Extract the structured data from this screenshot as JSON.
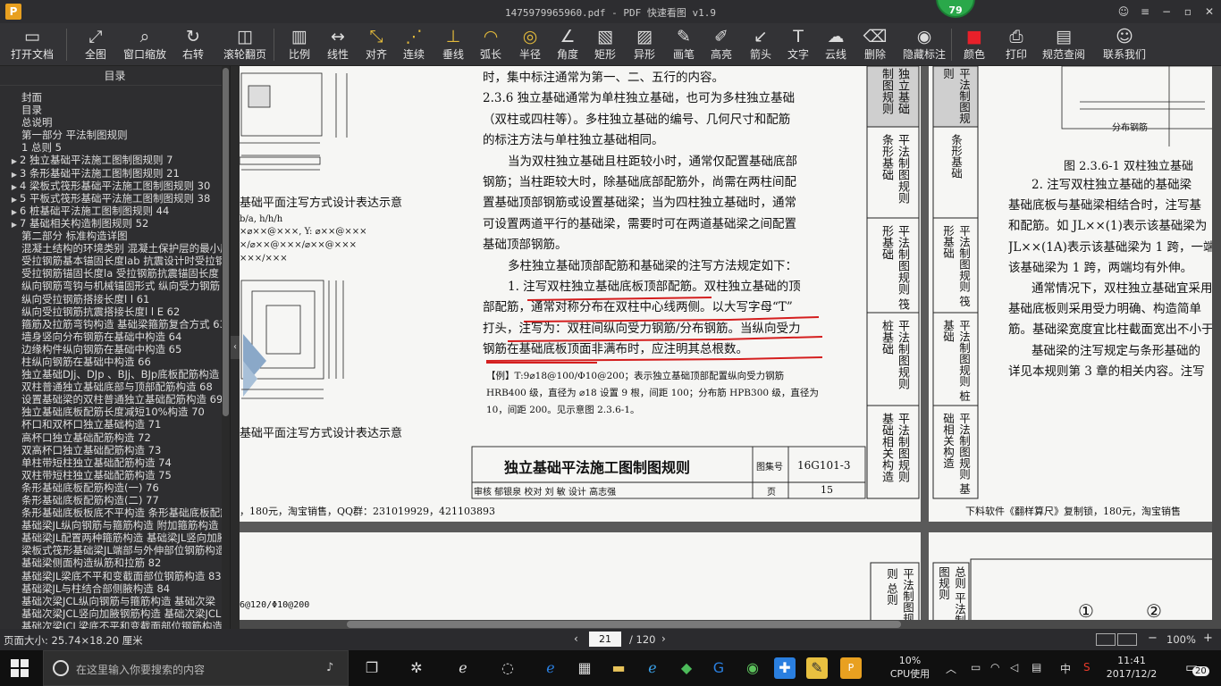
{
  "window": {
    "title": "1475979965960.pdf - PDF 快速看图 v1.9",
    "badge": "79",
    "logo": "P"
  },
  "toolbar": [
    {
      "label": "打开文档",
      "icon": "folder-icon",
      "glyph": "▭"
    },
    {
      "label": "全图",
      "icon": "fit-all-icon",
      "glyph": "⤢"
    },
    {
      "label": "窗口缩放",
      "icon": "zoom-icon",
      "glyph": "⌕"
    },
    {
      "label": "右转",
      "icon": "rotate-right-icon",
      "glyph": "↻"
    },
    {
      "label": "滚轮翻页",
      "icon": "mouse-icon",
      "glyph": "◫"
    },
    {
      "label": "比例",
      "icon": "scale-icon",
      "glyph": "▥"
    },
    {
      "label": "线性",
      "icon": "linear-measure-icon",
      "glyph": "↔"
    },
    {
      "label": "对齐",
      "icon": "aligned-measure-icon",
      "glyph": "⤡"
    },
    {
      "label": "连续",
      "icon": "continuous-measure-icon",
      "glyph": "⋰"
    },
    {
      "label": "垂线",
      "icon": "perpendicular-icon",
      "glyph": "⊥"
    },
    {
      "label": "弧长",
      "icon": "arc-length-icon",
      "glyph": "◠"
    },
    {
      "label": "半径",
      "icon": "radius-icon",
      "glyph": "◎"
    },
    {
      "label": "角度",
      "icon": "angle-icon",
      "glyph": "∠"
    },
    {
      "label": "矩形",
      "icon": "rectangle-area-icon",
      "glyph": "▧"
    },
    {
      "label": "异形",
      "icon": "irregular-area-icon",
      "glyph": "▨"
    },
    {
      "label": "画笔",
      "icon": "pen-icon",
      "glyph": "✎"
    },
    {
      "label": "高亮",
      "icon": "highlighter-icon",
      "glyph": "✐"
    },
    {
      "label": "箭头",
      "icon": "arrow-icon",
      "glyph": "↙"
    },
    {
      "label": "文字",
      "icon": "text-icon",
      "glyph": "T"
    },
    {
      "label": "云线",
      "icon": "cloud-line-icon",
      "glyph": "☁"
    },
    {
      "label": "删除",
      "icon": "eraser-icon",
      "glyph": "⌫"
    },
    {
      "label": "隐藏标注",
      "icon": "hide-annotations-icon",
      "glyph": "◉"
    },
    {
      "label": "颜色",
      "icon": "color-swatch-icon",
      "glyph": "■",
      "color": "#e8202a"
    },
    {
      "label": "打印",
      "icon": "printer-icon",
      "glyph": "⎙"
    },
    {
      "label": "规范查阅",
      "icon": "book-search-icon",
      "glyph": "▤"
    },
    {
      "label": "联系我们",
      "icon": "contact-icon",
      "glyph": "☺"
    }
  ],
  "sidebar": {
    "title": "目录",
    "items": [
      {
        "text": "封面",
        "arrow": false
      },
      {
        "text": "目录",
        "arrow": false
      },
      {
        "text": "总说明",
        "arrow": false
      },
      {
        "text": "第一部分  平法制图规则",
        "arrow": false
      },
      {
        "text": "1 总则 5",
        "arrow": false
      },
      {
        "text": "2 独立基础平法施工图制图规则 7",
        "arrow": true
      },
      {
        "text": "3 条形基础平法施工图制图规则 21",
        "arrow": true
      },
      {
        "text": "4 梁板式筏形基础平法施工图制图规则 30",
        "arrow": true
      },
      {
        "text": "5 平板式筏形基础平法施工图制图规则 38",
        "arrow": true
      },
      {
        "text": "6 桩基础平法施工图制图规则 44",
        "arrow": true
      },
      {
        "text": "7 基础相关构造制图规则 52",
        "arrow": true
      },
      {
        "text": "第二部分  标准构造详图",
        "arrow": false
      },
      {
        "text": "混凝土结构的环境类别  混凝土保护层的最小厚度",
        "arrow": false
      },
      {
        "text": "受拉钢筋基本锚固长度lab 抗震设计时受拉钢筋",
        "arrow": false
      },
      {
        "text": "受拉钢筋锚固长度la 受拉钢筋抗震锚固长度",
        "arrow": false
      },
      {
        "text": "纵向钢筋弯钩与机械锚固形式  纵向受力钢筋",
        "arrow": false
      },
      {
        "text": "纵向受拉钢筋搭接长度l l 61",
        "arrow": false
      },
      {
        "text": "纵向受拉钢筋抗震搭接长度l l E 62",
        "arrow": false
      },
      {
        "text": "箍筋及拉筋弯钩构造  基础梁箍筋复合方式 63",
        "arrow": false
      },
      {
        "text": "墙身竖向分布钢筋在基础中构造 64",
        "arrow": false
      },
      {
        "text": "边缘构件纵向钢筋在基础中构造 65",
        "arrow": false
      },
      {
        "text": "柱纵向钢筋在基础中构造 66",
        "arrow": false
      },
      {
        "text": "独立基础DJj、DJp 、BJj、BJp底板配筋构造",
        "arrow": false
      },
      {
        "text": "双柱普通独立基础底部与顶部配筋构造 68",
        "arrow": false
      },
      {
        "text": "设置基础梁的双柱普通独立基础配筋构造 69",
        "arrow": false
      },
      {
        "text": "独立基础底板配筋长度减短10%构造 70",
        "arrow": false
      },
      {
        "text": "杯口和双杯口独立基础构造 71",
        "arrow": false
      },
      {
        "text": "高杯口独立基础配筋构造 72",
        "arrow": false
      },
      {
        "text": "双高杯口独立基础配筋构造 73",
        "arrow": false
      },
      {
        "text": "单柱带短柱独立基础配筋构造 74",
        "arrow": false
      },
      {
        "text": "双柱带短柱独立基础配筋构造 75",
        "arrow": false
      },
      {
        "text": "条形基础底板配筋构造(一) 76",
        "arrow": false
      },
      {
        "text": "条形基础底板配筋构造(二) 77",
        "arrow": false
      },
      {
        "text": "条形基础底板板底不平构造  条形基础底板配筋",
        "arrow": false
      },
      {
        "text": "基础梁JL纵向钢筋与箍筋构造  附加箍筋构造",
        "arrow": false
      },
      {
        "text": "基础梁JL配置两种箍筋构造  基础梁JL竖向加腋",
        "arrow": false
      },
      {
        "text": "梁板式筏形基础梁JL端部与外伸部位钢筋构造",
        "arrow": false
      },
      {
        "text": "基础梁侧面构造纵筋和拉筋 82",
        "arrow": false
      },
      {
        "text": "基础梁JL梁底不平和变截面部位钢筋构造 83",
        "arrow": false
      },
      {
        "text": "基础梁JL与柱结合部侧腋构造 84",
        "arrow": false
      },
      {
        "text": "基础次梁JCL纵向钢筋与箍筋构造  基础次梁",
        "arrow": false
      },
      {
        "text": "基础次梁JCL竖向加腋钢筋构造  基础次梁JCL",
        "arrow": false
      },
      {
        "text": "基础次梁JCL梁底不平和变截面部位钢筋构造",
        "arrow": false
      }
    ]
  },
  "document": {
    "heading_236": "2.3.6  独立基础通常为单柱独立基础，也可为多柱独立基础",
    "para_lines": [
      "时，集中标注通常为第一、二、五行的内容。",
      "（双柱或四柱等）。多柱独立基础的编号、几何尺寸和配筋",
      "的标注方法与单柱独立基础相同。",
      "当为双柱独立基础且柱距较小时，通常仅配置基础底部",
      "钢筋；当柱距较大时，除基础底部配筋外，尚需在两柱间配",
      "置基础顶部钢筋或设置基础梁；当为四柱独立基础时，通常",
      "可设置两道平行的基础梁，需要时可在两道基础梁之间配置",
      "基础顶部钢筋。",
      "多柱独立基础顶部配筋和基础梁的注写方法规定如下：",
      "1. 注写双柱独立基础底板顶部配筋。双柱独立基础的顶",
      "部配筋，通常对称分布在双柱中心线两侧。以大写字母“T”",
      "打头，注写为：双柱间纵向受力钢筋/分布钢筋。当纵向受力",
      "钢筋在基础底板顶面非满布时，应注明其总根数。"
    ],
    "example_lines": [
      "【例】T:9⌀18@100/Φ10@200；表示独立基础顶部配置纵向受力钢筋",
      "HRB400 级，直径为 ⌀18 设置 9 根，间距 100；分布筋 HPB300 级，直径为",
      "10，间距 200。见示意图 2.3.6-1。"
    ],
    "title_block": {
      "title": "独立基础平法施工图制图规则",
      "atlas_label": "图集号",
      "atlas_no": "16G101-3",
      "review_row": "审核  郁银泉  校对  刘  敏  设计  高志强",
      "page_label": "页",
      "page_no": "15"
    },
    "left_fragment": {
      "caption1": "基础平面注写方式设计表达示意",
      "caption2": "基础平面注写方式设计表达示意",
      "formula1": "b/a, h/h/h",
      "formula2": "×⌀××@×××, Y: ⌀××@×××",
      "formula3": "×/⌀××@×××/⌀××@×××",
      "formula4": "×××/×××",
      "bottom_note": "，180元，淘宝销售，QQ群：231019929，421103893",
      "lower_note": "6@120/Φ10@200"
    },
    "tabs_a": [
      "独立基础制图规则",
      "平法制图规则 条形基础",
      "平法制图规则 筏形基础",
      "平法制图规则 桩基础",
      "平法制图规则 基础相关构造"
    ],
    "tabs_b": [
      "平法制图规则",
      "条形基础",
      "平法制图规则 筏形基础",
      "平法制图规则 桩基础",
      "平法制图规则 基础相关构造"
    ],
    "right_page": {
      "fig_label": "分布钢筋",
      "caption": "图 2.3.6-1  双柱独立基础",
      "lines": [
        "2. 注写双柱独立基础的基础梁",
        "基础底板与基础梁相结合时，注写基",
        "和配筋。如 JL××(1)表示该基础梁为",
        "JL××(1A)表示该基础梁为 1 跨，一端",
        "该基础梁为 1 跨，两端均有外伸。",
        "通常情况下，双柱独立基础宜采用",
        "基础底板则采用受力明确、构造简单",
        "筋。基础梁宽度宜比柱截面宽出不小于",
        "基础梁的注写规定与条形基础的",
        "详见本规则第 3 章的相关内容。注写"
      ],
      "bottom_note": "下料软件《翻样算尺》复制锁，180元，淘宝销售"
    },
    "lower_tabs": [
      "平法制图规则 总则",
      "总则 平法制图规则"
    ],
    "circles": [
      "①",
      "②"
    ]
  },
  "status": {
    "page_size": "页面大小: 25.74×18.20 厘米",
    "current_page": "21",
    "total_pages": "/ 120",
    "zoom": "100%"
  },
  "taskbar": {
    "search_placeholder": "在这里输入你要搜索的内容",
    "cpu_value": "10%",
    "cpu_label": "CPU使用",
    "ime": "中",
    "time": "11:41",
    "date": "2017/12/2",
    "notifications": "20"
  }
}
